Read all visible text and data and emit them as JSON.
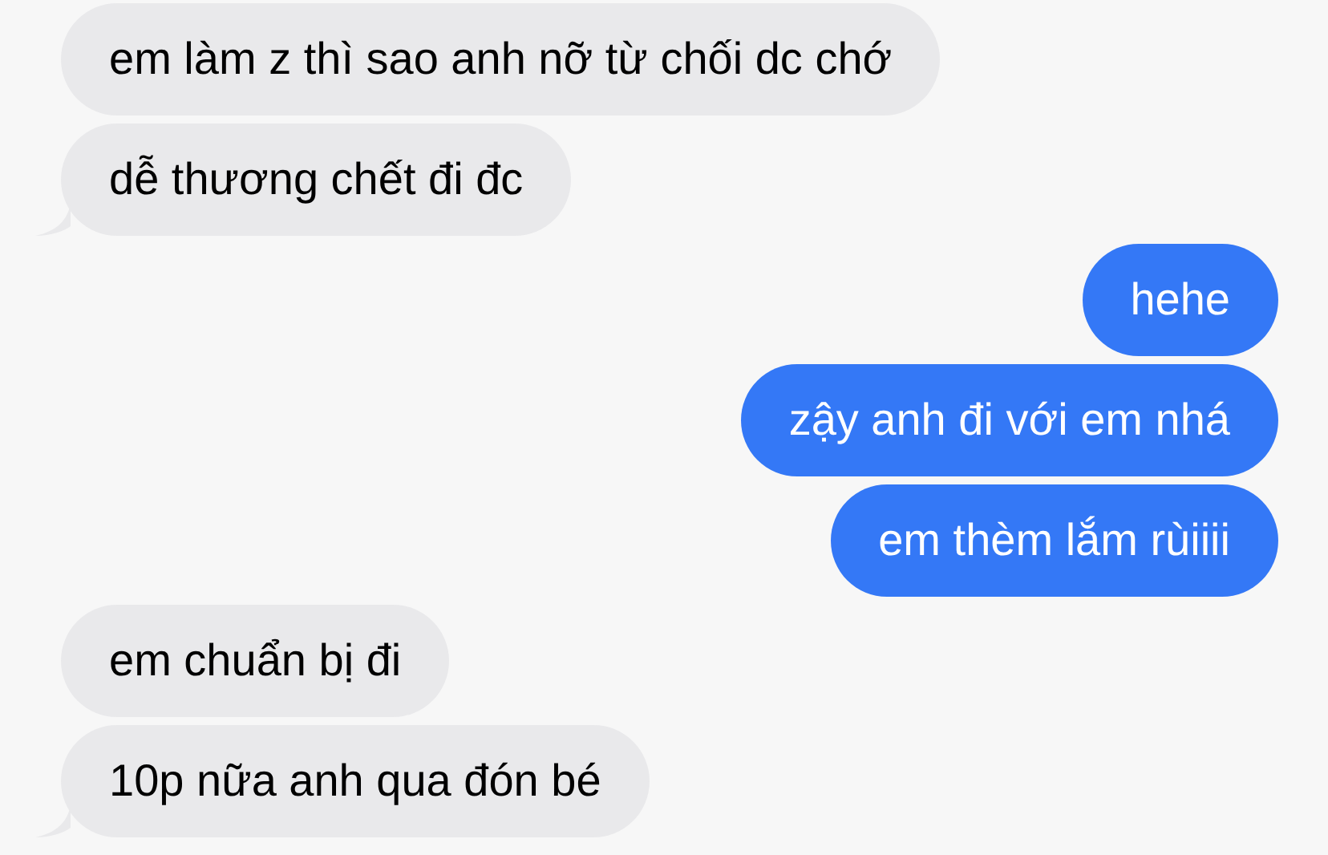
{
  "messages": [
    {
      "text": "em làm z thì sao anh nỡ từ chối dc chớ",
      "outgoing": false,
      "tail": false
    },
    {
      "text": "dễ thương chết đi đc",
      "outgoing": false,
      "tail": true
    },
    {
      "text": "hehe",
      "outgoing": true,
      "tail": false
    },
    {
      "text": "zậy anh đi với em nhá",
      "outgoing": true,
      "tail": false
    },
    {
      "text": "em thèm lắm rùiiii",
      "outgoing": true,
      "tail": false
    },
    {
      "text": "em chuẩn bị đi",
      "outgoing": false,
      "tail": false
    },
    {
      "text": "10p nữa anh qua đón bé",
      "outgoing": false,
      "tail": true
    }
  ]
}
